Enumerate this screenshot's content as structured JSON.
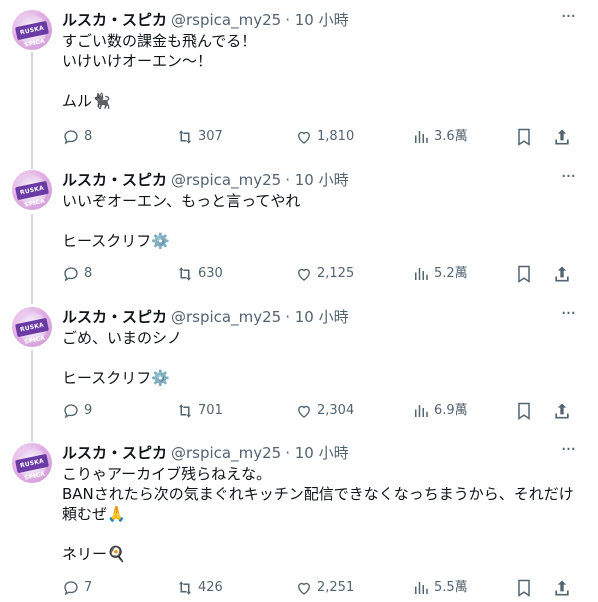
{
  "tweets": [
    {
      "name": "ルスカ・スピカ",
      "handle": "@rspica_my25",
      "time": "· 10 小時",
      "avatar_text": "RUSKA SPICA",
      "lines": [
        "すごい数の課金も飛んでる！",
        "いけいけオーエン〜！",
        "",
        "ムル🐈‍⬛"
      ],
      "replies": "8",
      "retweets": "307",
      "likes": "1,810",
      "views": "3.6萬"
    },
    {
      "name": "ルスカ・スピカ",
      "handle": "@rspica_my25",
      "time": "· 10 小時",
      "avatar_text": "RUSKA SPICA",
      "lines": [
        "いいぞオーエン、もっと言ってやれ",
        "",
        "ヒースクリフ⚙️"
      ],
      "replies": "8",
      "retweets": "630",
      "likes": "2,125",
      "views": "5.2萬"
    },
    {
      "name": "ルスカ・スピカ",
      "handle": "@rspica_my25",
      "time": "· 10 小時",
      "avatar_text": "RUSKA SPICA",
      "lines": [
        "ごめ、いまのシノ",
        "",
        "ヒースクリフ⚙️"
      ],
      "replies": "9",
      "retweets": "701",
      "likes": "2,304",
      "views": "6.9萬"
    },
    {
      "name": "ルスカ・スピカ",
      "handle": "@rspica_my25",
      "time": "· 10 小時",
      "avatar_text": "RUSKA SPICA",
      "lines": [
        "こりゃアーカイブ残らねえな。",
        "BANされたら次の気まぐれキッチン配信できなくなっちまうから、それだけ",
        "頼むぜ🙏",
        "",
        "ネリー🍳"
      ],
      "replies": "7",
      "retweets": "426",
      "likes": "2,251",
      "views": "5.5萬"
    }
  ],
  "colors": {
    "text": "#0f1419",
    "muted": "#536471",
    "thread_line": "#cfd9de"
  },
  "icons": [
    "reply-icon",
    "retweet-icon",
    "like-icon",
    "views-icon",
    "bookmark-icon",
    "share-icon",
    "more-icon"
  ]
}
